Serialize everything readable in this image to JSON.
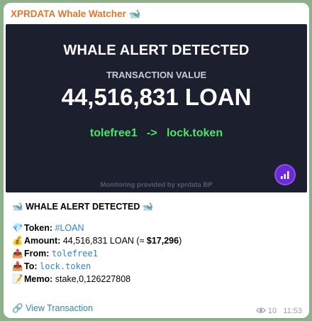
{
  "message": {
    "sender": "XPRDATA Whale Watcher",
    "sender_emoji": "🐋",
    "image_card": {
      "title": "WHALE ALERT DETECTED",
      "value_label": "TRANSACTION VALUE",
      "value": "44,516,831 LOAN",
      "from": "tolefree1",
      "arrow": "->",
      "to": "lock.token",
      "footer": "Monitoring provided by xprdata BP",
      "logo_icon": "bar-chart-icon"
    },
    "text": {
      "headline_emoji": "🐋",
      "headline": "WHALE ALERT DETECTED",
      "token_emoji": "💎",
      "token_label": "Token:",
      "token_value": "#LOAN",
      "amount_emoji": "💰",
      "amount_label": "Amount:",
      "amount_value": "44,516,831 LOAN (≈ ",
      "amount_usd": "$17,296",
      "amount_close": ")",
      "from_emoji": "📤",
      "from_label": "From:",
      "from_value": "tolefree1",
      "to_emoji": "📥",
      "to_label": "To:",
      "to_value": "lock.token",
      "memo_emoji": "📝",
      "memo_label": "Memo:",
      "memo_value": "stake,0,126227808",
      "link_emoji": "🔗",
      "link_label": "View Transaction"
    },
    "views": "10",
    "time": "11:53"
  },
  "colors": {
    "sender": "#e2762b",
    "card_bg": "#1b1f2e",
    "flow_green": "#4fe36a",
    "link": "#2f83c6",
    "chat_bg": "#8fb08a"
  }
}
